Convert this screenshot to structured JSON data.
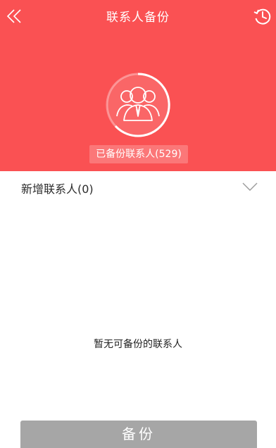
{
  "colors": {
    "header_bg": "#fa5153",
    "button_bg": "#a6a6a6"
  },
  "topbar": {
    "title": "联系人备份",
    "back_icon": "double-chevron-left-icon",
    "history_icon": "history-clock-icon"
  },
  "status": {
    "backed_up_text": "已备份联系人(529)",
    "avatar_icon": "contacts-group-icon"
  },
  "new_contacts": {
    "label": "新增联系人(0)",
    "expand_icon": "chevron-down-icon"
  },
  "empty_message": "暂无可备份的联系人",
  "backup_button": {
    "label": "备份"
  }
}
